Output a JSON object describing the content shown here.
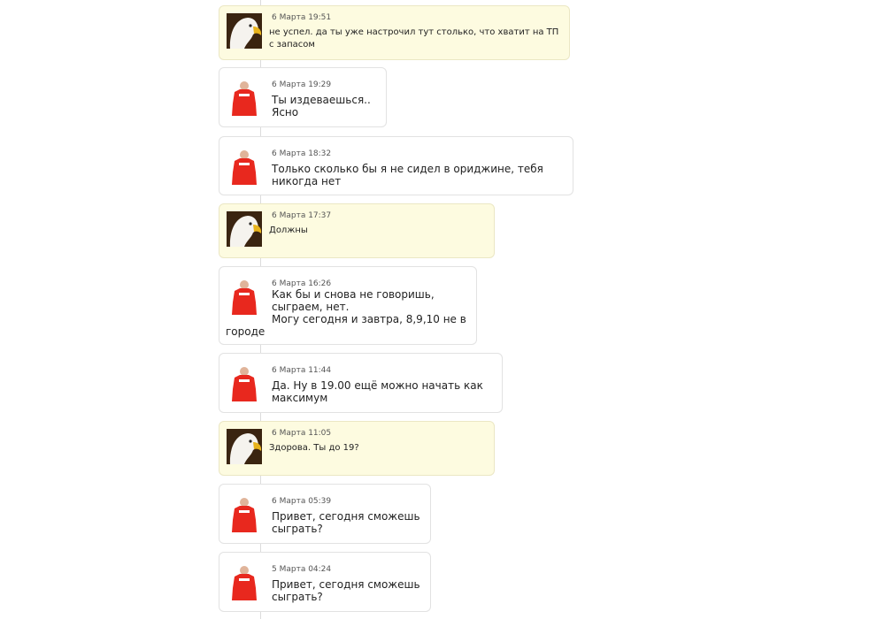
{
  "messages": [
    {
      "author": "eagle",
      "own": true,
      "timestamp": "6 Марта 19:51",
      "lines": [
        "не успел. да ты уже настрочил тут столько, что хватит на ТП",
        "с запасом"
      ]
    },
    {
      "author": "red-shirt",
      "own": false,
      "timestamp": "6 Марта 19:29",
      "lines": [
        "Ты издеваешься..",
        "Ясно"
      ]
    },
    {
      "author": "red-shirt",
      "own": false,
      "timestamp": "6 Марта 18:32",
      "lines": [
        "Только сколько бы я не сидел в ориджине, тебя",
        "никогда нет"
      ]
    },
    {
      "author": "eagle",
      "own": true,
      "timestamp": "6 Марта 17:37",
      "lines": [
        "Должны"
      ]
    },
    {
      "author": "red-shirt",
      "own": false,
      "timestamp": "6 Марта 16:26",
      "lines": [
        "Как бы и снова не говоришь,",
        "сыграем, нет.",
        "Могу сегодня и завтра, 8,9,10 не в",
        "городе"
      ]
    },
    {
      "author": "red-shirt",
      "own": false,
      "timestamp": "6 Марта 11:44",
      "lines": [
        "Да. Ну в 19.00 ещё можно начать как",
        "максимум"
      ]
    },
    {
      "author": "eagle",
      "own": true,
      "timestamp": "6 Марта 11:05",
      "lines": [
        "Здорова. Ты до 19?"
      ]
    },
    {
      "author": "red-shirt",
      "own": false,
      "timestamp": "6 Марта 05:39",
      "lines": [
        "Привет, сегодня сможешь",
        "сыграть?"
      ]
    },
    {
      "author": "red-shirt",
      "own": false,
      "timestamp": "5 Марта 04:24",
      "lines": [
        "Привет, сегодня сможешь",
        "сыграть?"
      ]
    }
  ],
  "avatars": {
    "eagle": "eagle-avatar-icon",
    "red-shirt": "red-shirt-avatar-icon"
  },
  "colors": {
    "own_bubble": "#fdfbe0",
    "other_bubble": "#ffffff",
    "border": "#e2e2e2",
    "shirt_red": "#e8281e"
  },
  "shirt_logo": "ITEM"
}
